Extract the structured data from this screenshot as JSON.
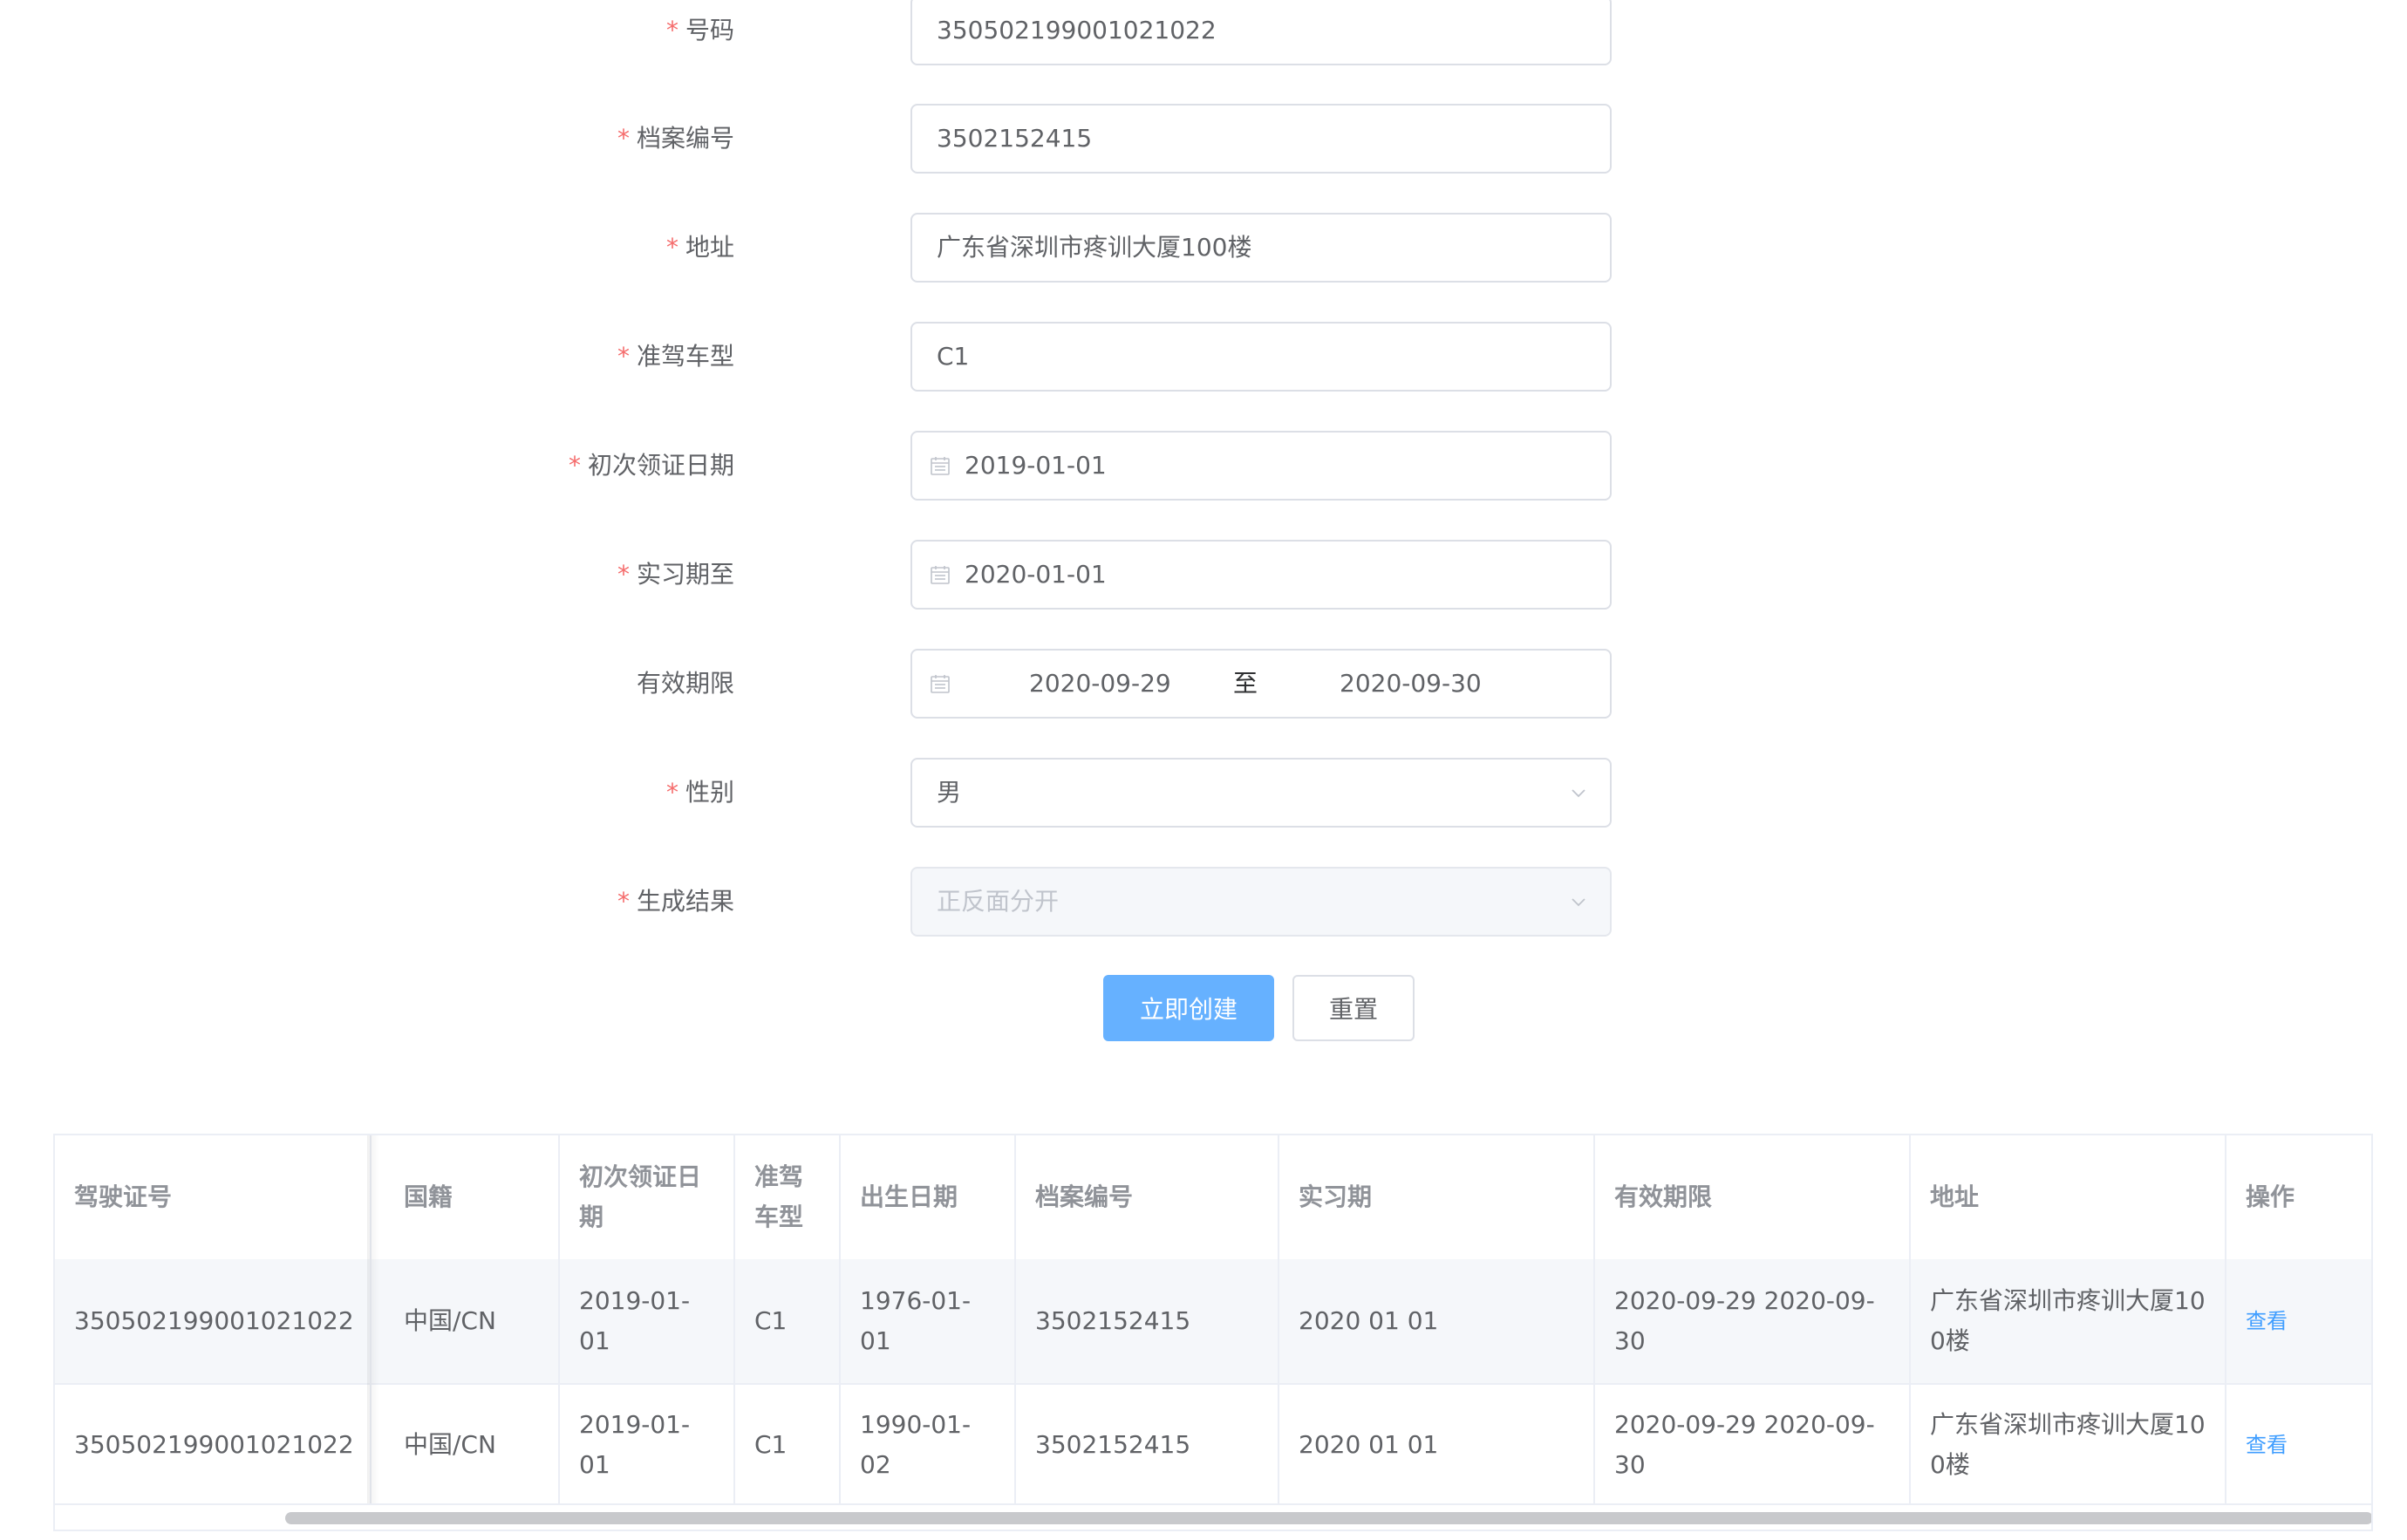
{
  "form": {
    "fields": [
      {
        "label": "号码",
        "required": true,
        "value": "350502199001021022",
        "type": "text"
      },
      {
        "label": "档案编号",
        "required": true,
        "value": "3502152415",
        "type": "text"
      },
      {
        "label": "地址",
        "required": true,
        "value": "广东省深圳市疼训大厦100楼",
        "type": "text"
      },
      {
        "label": "准驾车型",
        "required": true,
        "value": "C1",
        "type": "text"
      },
      {
        "label": "初次领证日期",
        "required": true,
        "value": "2019-01-01",
        "type": "date"
      },
      {
        "label": "实习期至",
        "required": true,
        "value": "2020-01-01",
        "type": "date"
      },
      {
        "label": "有效期限",
        "required": false,
        "start": "2020-09-29",
        "separator": "至",
        "end": "2020-09-30",
        "type": "daterange"
      },
      {
        "label": "性别",
        "required": true,
        "value": "男",
        "type": "select"
      },
      {
        "label": "生成结果",
        "required": true,
        "value": "正反面分开",
        "type": "select",
        "disabled": true
      }
    ],
    "required_mark": "*",
    "submit_label": "立即创建",
    "reset_label": "重置"
  },
  "table": {
    "columns": [
      "驾驶证号",
      "国籍",
      "初次领证日期",
      "准驾车型",
      "出生日期",
      "档案编号",
      "实习期",
      "有效期限",
      "地址",
      "操作"
    ],
    "rows": [
      [
        "350502199001021022",
        "中国/CN",
        "2019-01-01",
        "C1",
        "1976-01-01",
        "3502152415",
        "2020 01 01",
        "2020-09-29 2020-09-30",
        "广东省深圳市疼训大厦100楼",
        "查看"
      ],
      [
        "350502199001021022",
        "中国/CN",
        "2019-01-01",
        "C1",
        "1990-01-02",
        "3502152415",
        "2020 01 01",
        "2020-09-29 2020-09-30",
        "广东省深圳市疼训大厦100楼",
        "查看"
      ]
    ]
  },
  "colors": {
    "primary": "#66b1ff",
    "link": "#409eff",
    "required": "#f56c6c",
    "border": "#dcdfe6"
  }
}
